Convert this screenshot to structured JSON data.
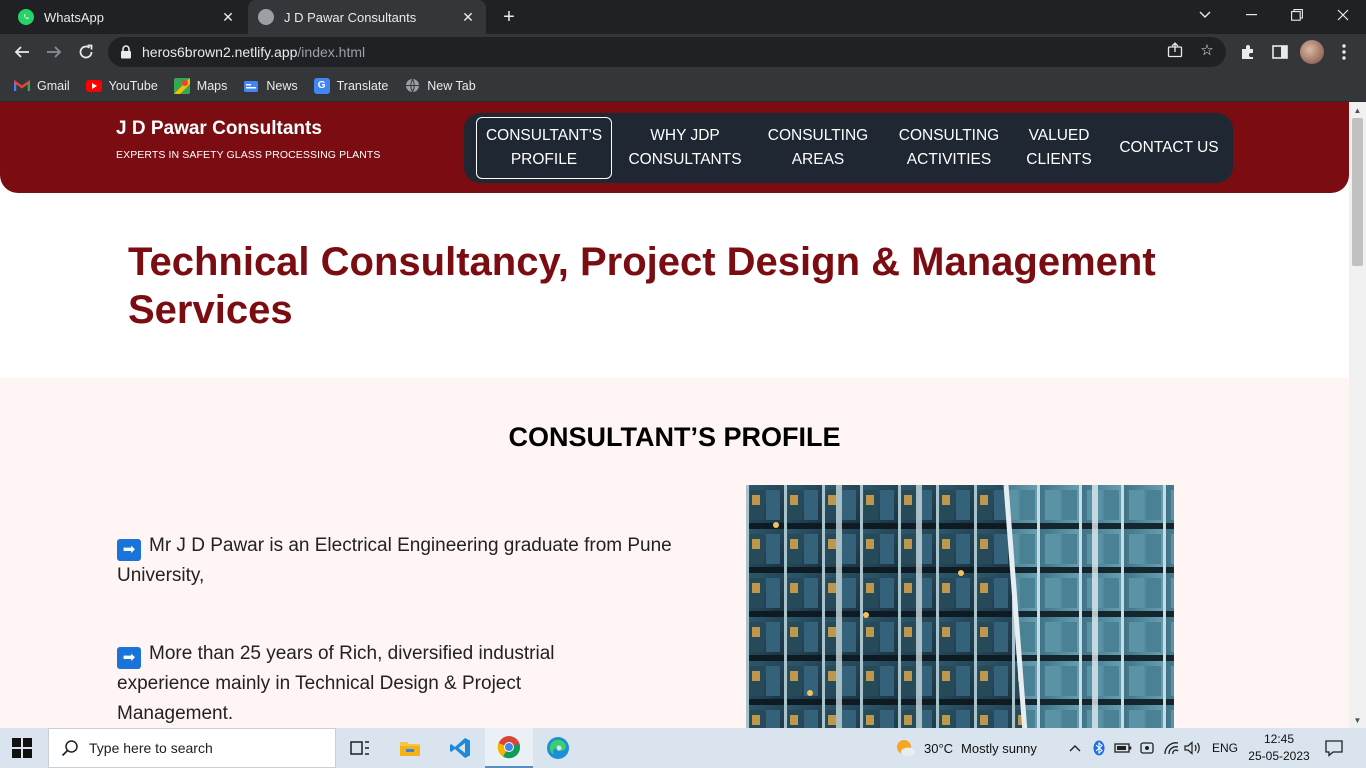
{
  "browser": {
    "tabs": [
      {
        "title": "WhatsApp",
        "favicon": "whatsapp-icon",
        "color": "#25d366"
      },
      {
        "title": "J D Pawar Consultants",
        "favicon": "globe-icon",
        "color": "#9aa0a6"
      }
    ],
    "url_domain": "heros6brown2.netlify.app",
    "url_path": "/index.html",
    "bookmarks": [
      {
        "label": "Gmail",
        "icon": "gmail-icon"
      },
      {
        "label": "YouTube",
        "icon": "youtube-icon"
      },
      {
        "label": "Maps",
        "icon": "maps-icon"
      },
      {
        "label": "News",
        "icon": "news-icon"
      },
      {
        "label": "Translate",
        "icon": "translate-icon"
      },
      {
        "label": "New Tab",
        "icon": "globe-icon"
      }
    ]
  },
  "site": {
    "brand_name": "J D Pawar Consultants",
    "tagline": "EXPERTS IN SAFETY GLASS PROCESSING PLANTS",
    "nav": [
      {
        "line1": "CONSULTANT'S",
        "line2": "PROFILE",
        "active": true
      },
      {
        "line1": "WHY JDP",
        "line2": "CONSULTANTS",
        "active": false
      },
      {
        "line1": "CONSULTING",
        "line2": "AREAS",
        "active": false
      },
      {
        "line1": "CONSULTING",
        "line2": "ACTIVITIES",
        "active": false
      },
      {
        "line1": "VALUED",
        "line2": "CLIENTS",
        "active": false
      },
      {
        "line1": "CONTACT US",
        "line2": "",
        "active": false
      }
    ],
    "hero_title_line1": "Technical Consultancy, Project Design & Management",
    "hero_title_line2": "Services",
    "section_title": "CONSULTANT’S PROFILE",
    "points": [
      "Mr J D Pawar is an Electrical Engineering graduate from Pune University,",
      "More than 25 years of Rich, diversified industrial experience mainly in Technical Design & Project Management."
    ],
    "accent_color": "#7b0d12",
    "nav_bg_color": "#1f2733"
  },
  "taskbar": {
    "search_placeholder": "Type here to search",
    "weather_temp": "30°C",
    "weather_desc": "Mostly sunny",
    "language": "ENG",
    "time": "12:45",
    "date": "25-05-2023"
  }
}
